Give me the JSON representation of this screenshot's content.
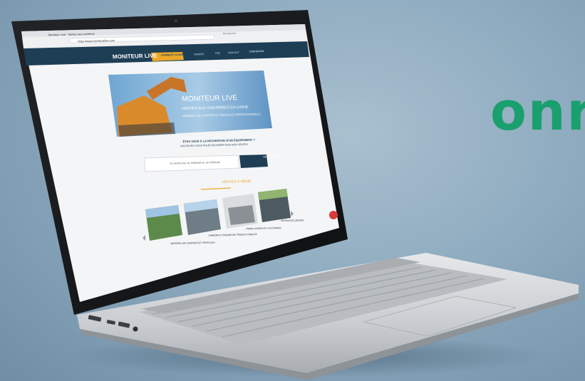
{
  "brand": {
    "text": "onr"
  },
  "browser": {
    "tab_title": "Moniteur Live - Ventes aux enchères",
    "url": "https://www.moniteurlive.com",
    "search_placeholder": "Rechercher"
  },
  "site": {
    "logo": "MONITEUR LIVE",
    "nav": [
      "COMMENT ÇA MARCHE",
      "VENDRE",
      "FAQ",
      "CONTACT"
    ],
    "nav_button": "CONNEXION",
    "hero_title": "MONITEUR LIVE",
    "hero_subtitle": "VENTES AUX ENCHÈRES EN LIGNE",
    "hero_line": "MATÉRIEL DE CHANTIER ET VÉHICULES PROFESSIONNELS",
    "intro_1": "ÊTES-VOUS À LA RECHERCHE D'UN ÉQUIPEMENT ?",
    "intro_2": "INSCRIVEZ-VOUS POUR ENCHÉRIR SUR NOS VENTES",
    "search_placeholder": "Je recherche un matériel ou un véhicule",
    "search_button": "RECHERCHER",
    "section_title": "VENTES À VENIR",
    "cards": [
      {
        "caption": "MATÉRIEL DE CHANTIER ET VÉHICULES"
      },
      {
        "caption": "CAMIONS ET ENGINS DE TRAVAUX PUBLICS"
      },
      {
        "caption": "POIDS LOURDS ET UTILITAIRES"
      },
      {
        "caption": "VÉHICULES LÉGERS"
      }
    ]
  },
  "colors": {
    "brand_green": "#1a9f6e",
    "nav_dark": "#1e3e56",
    "nav_accent": "#e9a82a",
    "page_bg": "#f4f5f6",
    "laptop_silver": "#c9ccd0"
  }
}
